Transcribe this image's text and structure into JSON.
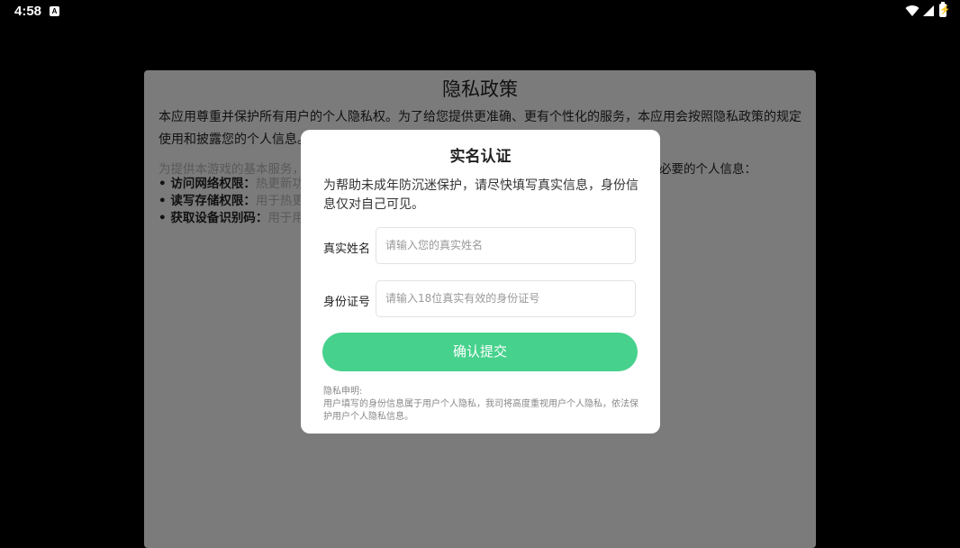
{
  "status_bar": {
    "time": "4:58",
    "app_icon_letter": "A",
    "battery_glyph": "⚡"
  },
  "privacy_policy": {
    "title": "隐私政策",
    "paragraph": "本应用尊重并保护所有用户的个人隐私权。为了给您提供更准确、更有个性化的服务，本应用会按照隐私政策的规定使用和披露您的个人信息。",
    "intro": "为提供本游戏的基本服务，",
    "intro_tail": "必要的个人信息：",
    "permissions": [
      {
        "title": "• 访问网络权限：",
        "desc": "热更新功"
      },
      {
        "title": "• 读写存储权限：",
        "desc": "用于热更"
      },
      {
        "title": "• 获取设备识别码：",
        "desc": "用于用"
      }
    ]
  },
  "dialog": {
    "title": "实名认证",
    "notice": "为帮助未成年防沉迷保护，请尽快填写真实信息，身份信息仅对自己可见。",
    "name_label": "真实姓名",
    "name_placeholder": "请输入您的真实姓名",
    "id_label": "身份证号",
    "id_placeholder": "请输入18位真实有效的身份证号",
    "submit_label": "确认提交",
    "disclaimer_title": "隐私申明:",
    "disclaimer_text": "用户填写的身份信息属于用户个人隐私，我司将高度重视用户个人隐私，依法保护用户个人隐私信息。"
  }
}
